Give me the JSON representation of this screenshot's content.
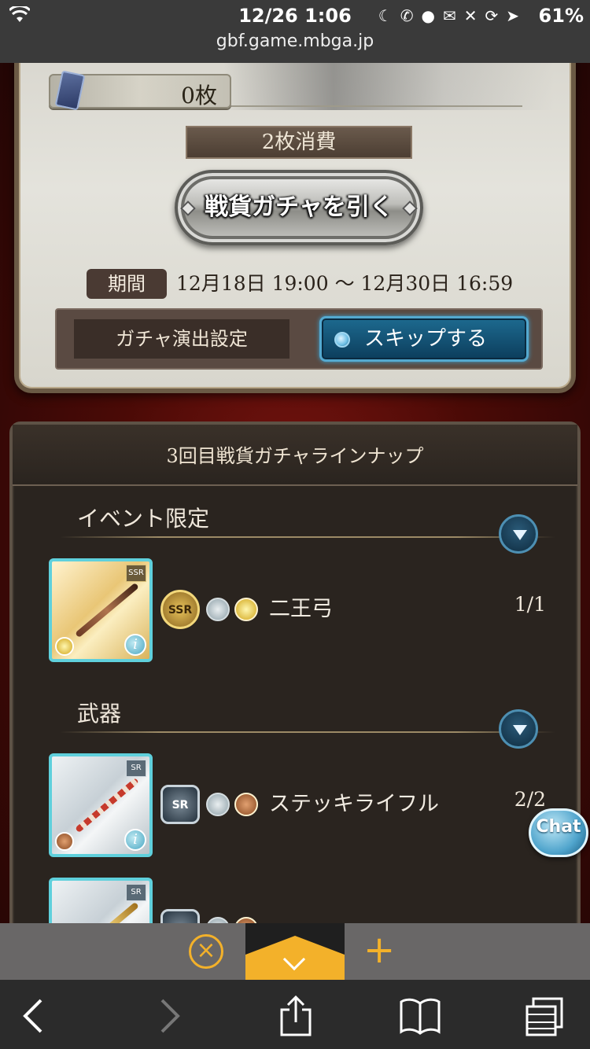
{
  "status_bar": {
    "time": "12/26 1:06",
    "url": "gbf.game.mbga.jp",
    "battery": "61%"
  },
  "gacha": {
    "ticket_count": "0枚",
    "consume_label": "2枚消費",
    "draw_button": "戦貨ガチャを引く",
    "period_label": "期間",
    "period_value": "12月18日 19:00 〜 12月30日 16:59",
    "setting_label": "ガチャ演出設定",
    "skip_button": "スキップする"
  },
  "lineup": {
    "title": "3回目戦貨ガチャラインナップ",
    "sections": [
      {
        "title": "イベント限定",
        "items": [
          {
            "name": "二王弓",
            "count": "1/1",
            "rarity": "SSR"
          }
        ]
      },
      {
        "title": "武器",
        "items": [
          {
            "name": "ステッキライフル",
            "count": "2/2",
            "rarity": "SR"
          }
        ]
      }
    ]
  },
  "chat_label": "Chat",
  "colors": {
    "accent": "#f3b12a",
    "skip_blue": "#1d6a8f",
    "background_red": "#7a1410"
  }
}
